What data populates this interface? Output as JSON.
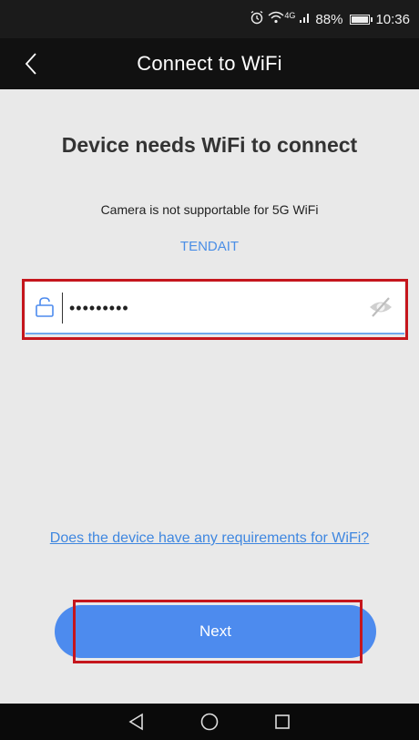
{
  "status_bar": {
    "alarm_icon": "alarm-clock-icon",
    "wifi_icon": "wifi-icon",
    "signal_label": "4G",
    "battery_percent": "88%",
    "time": "10:36"
  },
  "header": {
    "title": "Connect to WiFi",
    "back_icon": "chevron-left-icon"
  },
  "main": {
    "heading": "Device needs WiFi to connect",
    "note": "Camera is not supportable for 5G WiFi",
    "ssid": "TENDAIT",
    "password": {
      "value": "•••••••••",
      "lock_icon": "lock-icon",
      "visibility_icon": "eye-off-icon"
    },
    "requirements_link": "Does the device have any requirements for WiFi?",
    "next_button": "Next"
  },
  "colors": {
    "accent": "#4d8bee",
    "link": "#3f87e0",
    "highlight": "#c5161d",
    "background": "#e9e9e9",
    "header": "#111111"
  },
  "nav_bar": {
    "back": "triangle-back-icon",
    "home": "circle-home-icon",
    "recents": "square-recents-icon"
  }
}
